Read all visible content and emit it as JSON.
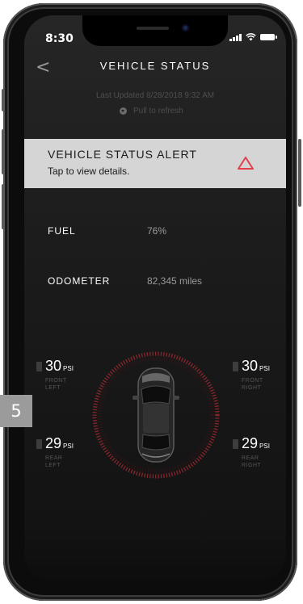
{
  "status_bar": {
    "time": "8:30"
  },
  "nav": {
    "back_label": "<",
    "title": "VEHICLE STATUS"
  },
  "refresh": {
    "last_updated": "Last Updated 8/28/2018 9:32 AM",
    "pull_label": "Pull to refresh"
  },
  "alert": {
    "title": "VEHICLE STATUS ALERT",
    "subtitle": "Tap to view details.",
    "icon_color": "#e2404c"
  },
  "stats": [
    {
      "label": "FUEL",
      "value": "76%"
    },
    {
      "label": "ODOMETER",
      "value": "82,345 miles"
    }
  ],
  "tires": {
    "unit": "PSI",
    "front_left": {
      "value": "30",
      "pos_line1": "FRONT",
      "pos_line2": "LEFT"
    },
    "front_right": {
      "value": "30",
      "pos_line1": "FRONT",
      "pos_line2": "RIGHT"
    },
    "rear_left": {
      "value": "29",
      "pos_line1": "REAR",
      "pos_line2": "LEFT"
    },
    "rear_right": {
      "value": "29",
      "pos_line1": "REAR",
      "pos_line2": "RIGHT"
    }
  },
  "page_badge": "5",
  "colors": {
    "accent_red": "#c8333b",
    "banner_bg": "#d5d5d5",
    "screen_bg": "#1e1e1e"
  }
}
